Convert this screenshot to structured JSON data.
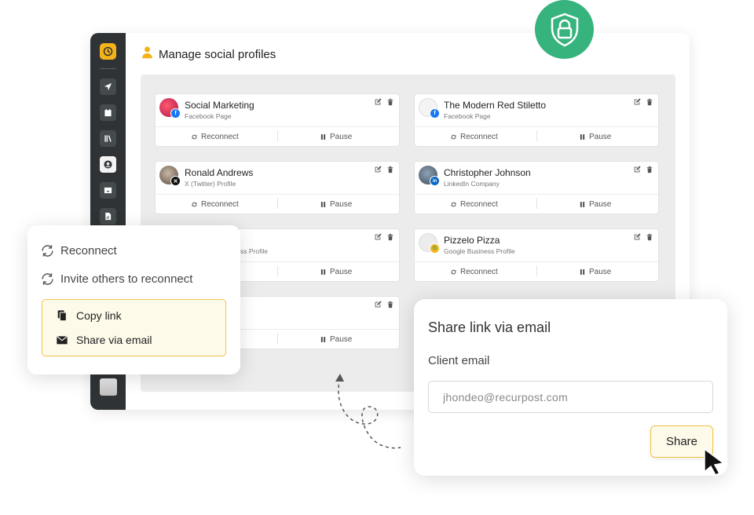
{
  "header": {
    "title": "Manage social profiles"
  },
  "profiles": [
    {
      "name": "Social Marketing",
      "type": "Facebook Page",
      "network": "facebook",
      "reconnect_label": "Reconnect",
      "pause_label": "Pause"
    },
    {
      "name": "The Modern Red Stiletto",
      "type": "Facebook Page",
      "network": "facebook",
      "reconnect_label": "Reconnect",
      "pause_label": "Pause"
    },
    {
      "name": "Ronald Andrews",
      "type": "X (Twitter) Profile",
      "network": "x",
      "reconnect_label": "Reconnect",
      "pause_label": "Pause"
    },
    {
      "name": "Christopher Johnson",
      "type": "LinkedIn Company",
      "network": "linkedin",
      "reconnect_label": "Reconnect",
      "pause_label": "Pause"
    },
    {
      "name": "",
      "type": "ss Profile",
      "network": "google",
      "reconnect_label": "",
      "pause_label": "Pause"
    },
    {
      "name": "Pizzelo Pizza",
      "type": "Google Business Profile",
      "network": "google",
      "reconnect_label": "Reconnect",
      "pause_label": "Pause"
    },
    {
      "name": "",
      "type": "",
      "network": "",
      "reconnect_label": "",
      "pause_label": "Pause"
    }
  ],
  "popover": {
    "reconnect": "Reconnect",
    "invite": "Invite others to reconnect",
    "copy_link": "Copy link",
    "share_via_email": "Share via email"
  },
  "share_dialog": {
    "title": "Share link via email",
    "email_label": "Client email",
    "email_value": "jhondeo@recurpost.com",
    "share_button": "Share"
  },
  "colors": {
    "accent_yellow": "#f5b31b",
    "shield_green": "#37b37e",
    "sidebar_bg": "#2f3335",
    "highlight_bg": "#fefaea",
    "highlight_border": "#f1c24a",
    "facebook": "#1877f2",
    "linkedin": "#0a66c2"
  },
  "icons": {
    "logo": "clock-icon",
    "shield": "shield-lock-icon",
    "sidebar": [
      "send-icon",
      "calendar-icon",
      "library-icon",
      "user-circle-icon",
      "inbox-icon",
      "report-icon"
    ]
  }
}
